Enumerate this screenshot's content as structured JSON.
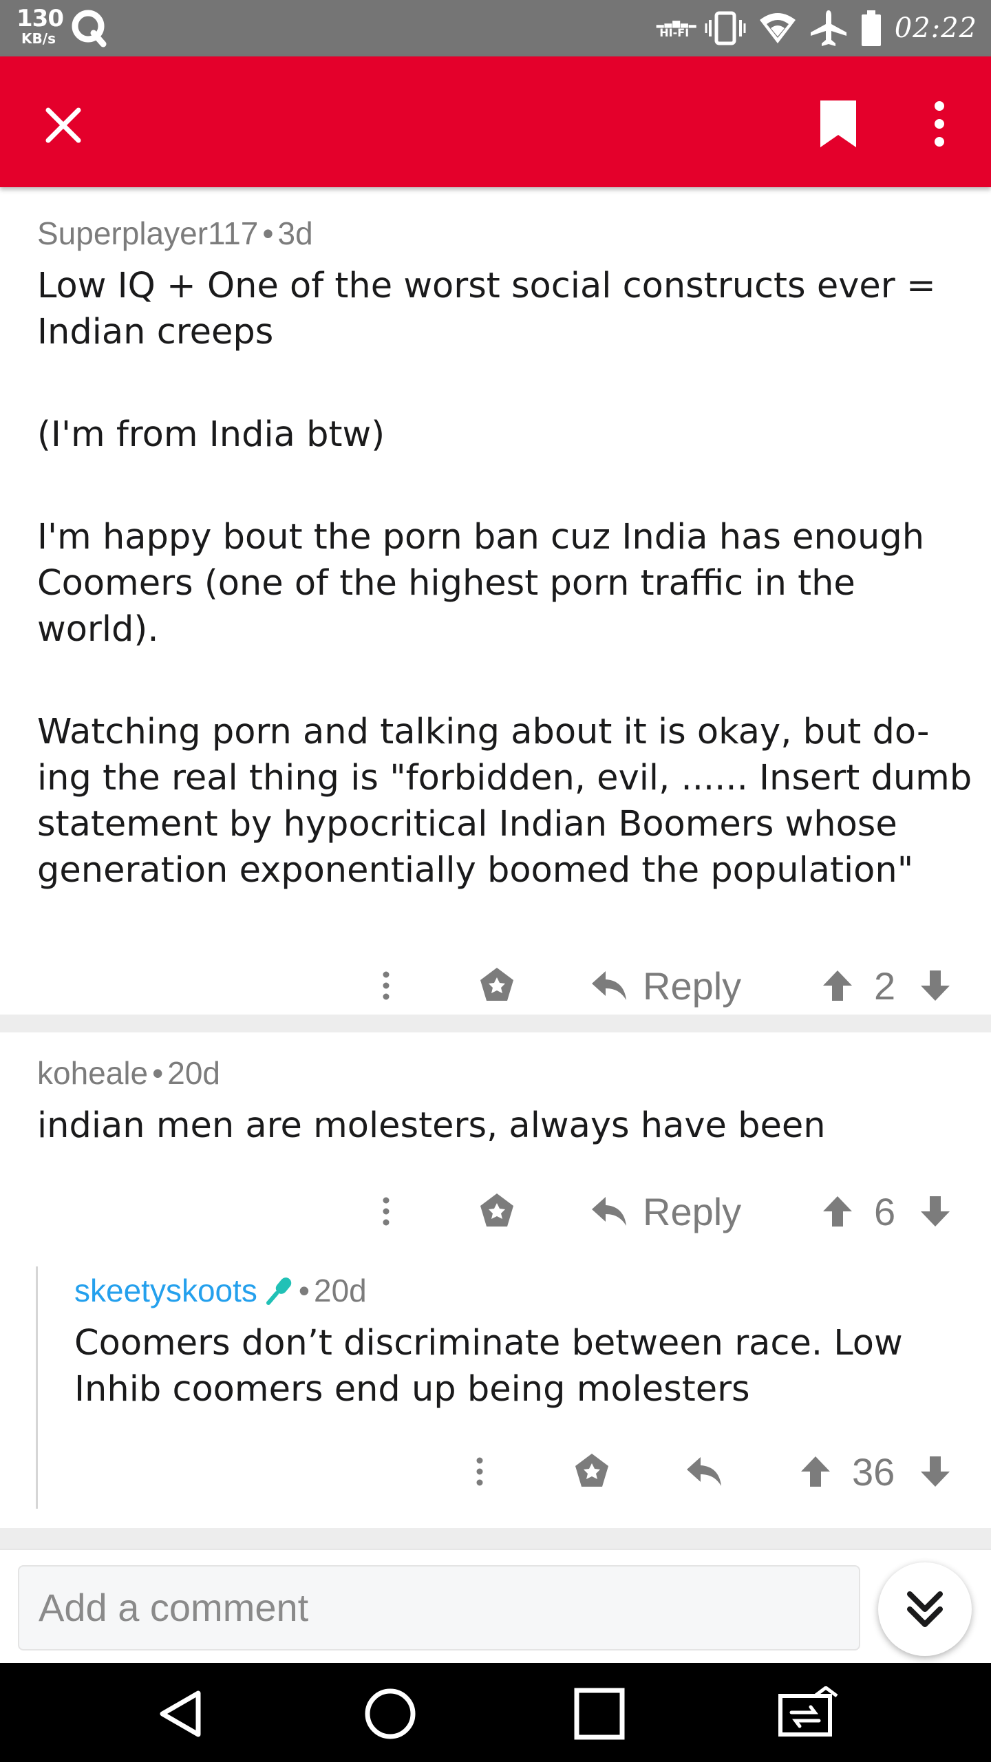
{
  "status_bar": {
    "speed_value": "130",
    "speed_unit": "KB/s",
    "hifi_label": "HI-FI",
    "time": "02:22"
  },
  "app_bar": {
    "accent_color": "#e4002b",
    "icons": [
      "close-icon",
      "bookmark-icon",
      "more-vert-icon"
    ]
  },
  "comments": [
    {
      "author": "Superplayer117",
      "age": "3d",
      "paragraphs": [
        "Low IQ + One of the worst social constructs ever = Indian creeps",
        "(I'm from India btw)",
        "I'm happy bout the porn ban cuz India has enough Coomers (one of the highest porn traffic in the world).",
        "Watching porn and talking about it is okay, but do-ing the real thing is \"forbidden, evil, ...... Insert dumb statement by hypocritical Indian Boomers whose generation exponentially boomed the population\""
      ],
      "reply_label": "Reply",
      "score": "2"
    },
    {
      "author": "koheale",
      "age": "20d",
      "paragraphs": [
        "indian men are molesters, always have been"
      ],
      "reply_label": "Reply",
      "score": "6"
    },
    {
      "author": "skeetyskoots",
      "author_color": "#24a0ed",
      "flair_icon": "microphone-icon",
      "age": "20d",
      "paragraphs": [
        "Coomers don’t discriminate between race. Low Inhib coomers end up being molesters"
      ],
      "score": "36"
    }
  ],
  "composer": {
    "placeholder": "Add a comment"
  }
}
